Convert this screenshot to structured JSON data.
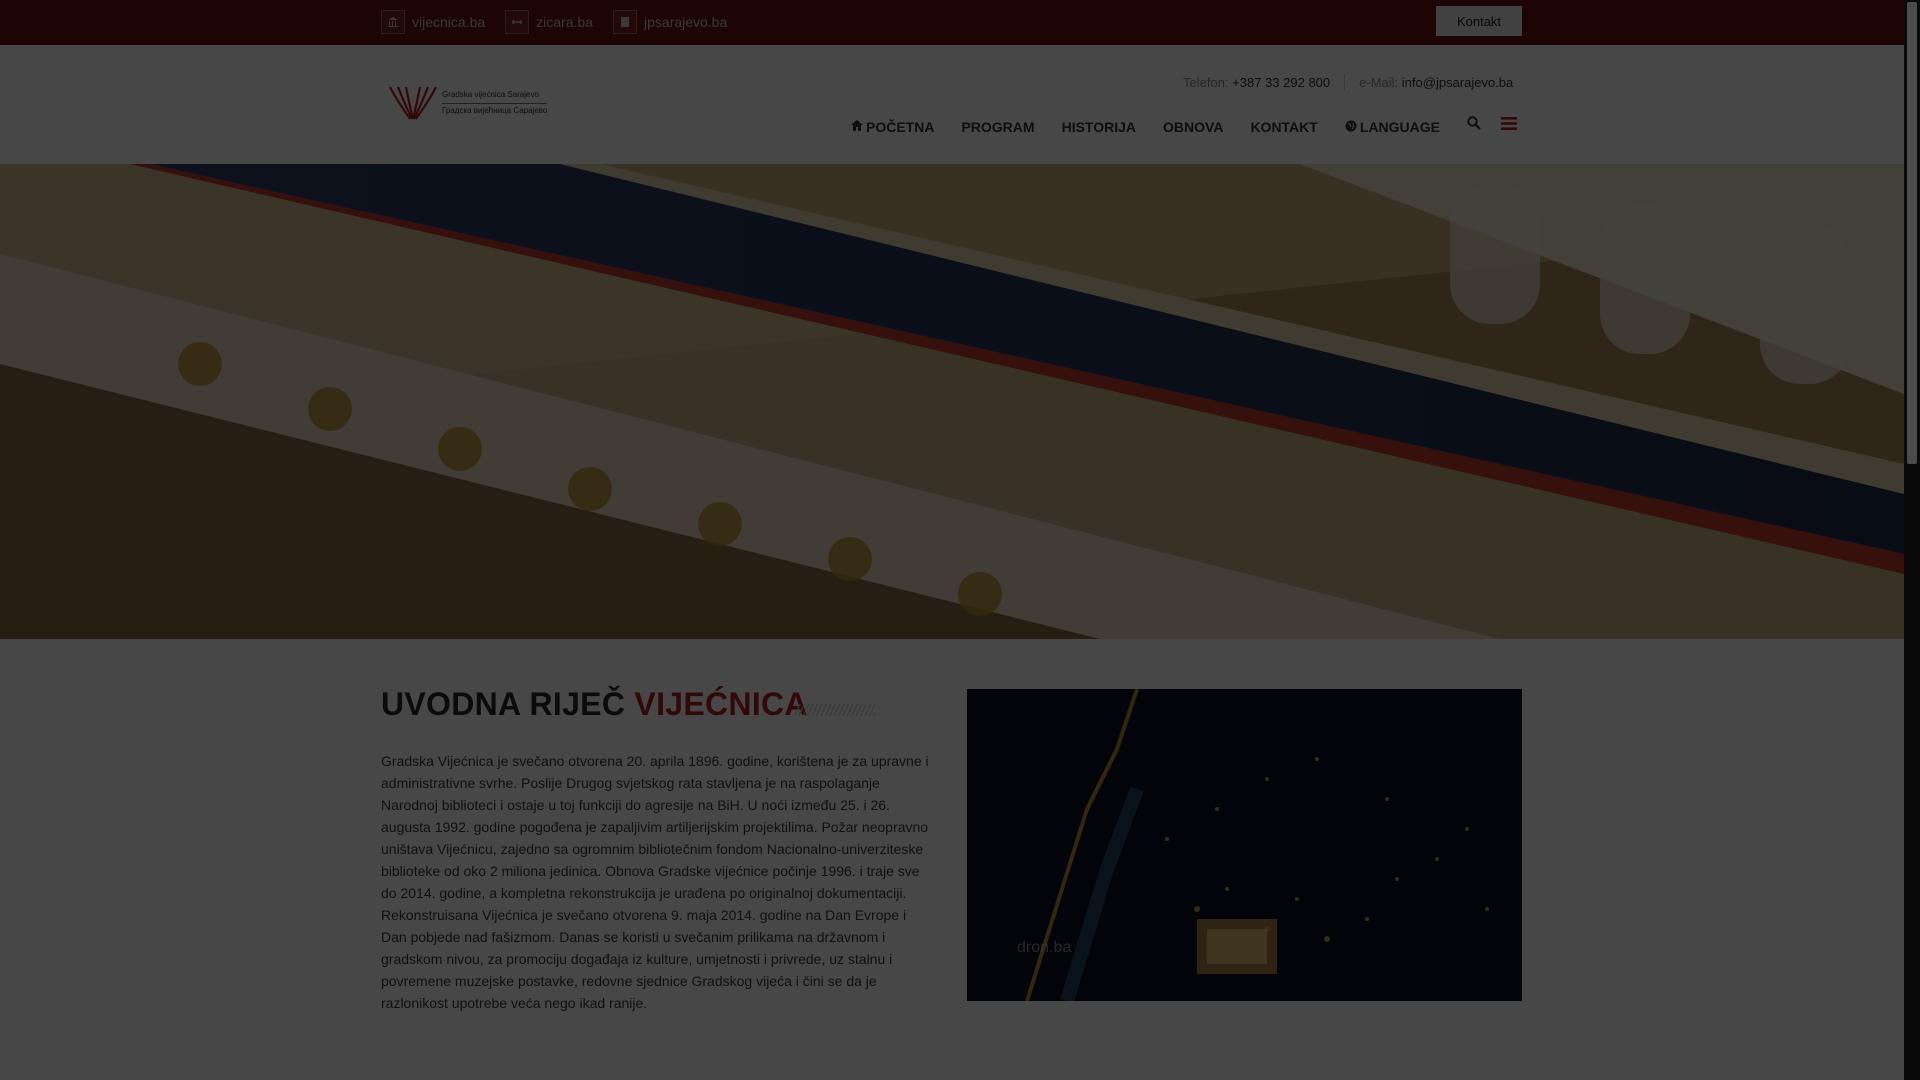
{
  "topbar": {
    "links": [
      {
        "label": "vijecnica.ba",
        "icon": "building-icon"
      },
      {
        "label": "zicara.ba",
        "icon": "cablecar-icon"
      },
      {
        "label": "jpsarajevo.ba",
        "icon": "document-icon"
      }
    ],
    "kontakt_button": "Kontakt"
  },
  "logo": {
    "line1": "Gradska vijećnica Sarajevo",
    "line2": "Градска вијећница Сарајево"
  },
  "contact": {
    "phone_label": "Telefon:",
    "phone": "+387 33 292 800",
    "email_label": "e-Mail:",
    "email": "info@jpsarajevo.ba"
  },
  "nav": {
    "items": [
      "POČETNA",
      "PROGRAM",
      "HISTORIJA",
      "OBNOVA",
      "KONTAKT",
      "LANGUAGE"
    ]
  },
  "intro": {
    "title_main": "UVODNA RIJEČ ",
    "title_accent": "VIJEĆNICA",
    "text": "Gradska Vijećnica je svečano otvorena 20. aprila 1896. godine, korištena je za upravne i administrativne svrhe. Poslije Drugog svjetskog rata stavljena je na raspolaganje Narodnoj biblioteci i ostaje u toj funkciji do agresije na BiH. U noći između 25. i 26. augusta 1992. godine pogođena je zapaljivim artiljerijskim projektilima. Požar neopravno uništava Vijećnicu, zajedno sa ogromnim bibliotečnim fondom Nacionalno-univerziteske biblioteke od oko 2 miliona jedinica. Obnova Gradske vijećnice počinje 1996. i traje sve do 2014. godine, a kompletna rekonstrukcija je urađena po originalnoj dokumentaciji. Rekonstruisana Vijećnica je svečano otvorena 9. maja 2014. godine na Dan Evrope i Dan pobjede nad fašizmom. Danas se koristi u svečanim prilikama na državnom i gradskom nivou, za promociju događaja iz kulture, umjetnosti i privrede, uz stalnu i povremene muzejske postavke, redovne sjednice Gradskog vijeća i čini se da je razlonikost upotrebe veća nego ikad ranije.",
    "photo_watermark": "dron.ba"
  },
  "colors": {
    "topbar": "#6a1212",
    "accent": "#b22222",
    "overlay": "rgba(0,0,0,0.72)"
  }
}
